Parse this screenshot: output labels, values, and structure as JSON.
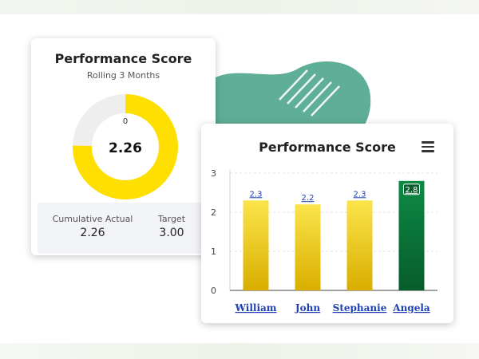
{
  "left_card": {
    "title": "Performance Score",
    "subtitle": "Rolling 3 Months",
    "donut": {
      "value": 2.26,
      "min_label": "0",
      "center_label": "2.26",
      "fraction": 0.753,
      "color": "#FFDF00",
      "track_color": "#EEEEEE"
    },
    "stats": [
      {
        "label": "Cumulative Actual",
        "value": "2.26"
      },
      {
        "label": "Target",
        "value": "3.00"
      }
    ]
  },
  "right_card": {
    "title": "Performance Score",
    "menu_icon": "hamburger-menu-icon"
  },
  "chart_data": {
    "type": "bar",
    "title": "Performance Score",
    "categories": [
      "William",
      "John",
      "Stephanie",
      "Angela"
    ],
    "values": [
      2.3,
      2.2,
      2.3,
      2.8
    ],
    "data_labels": [
      "2.3",
      "2.2",
      "2.3",
      "2.8"
    ],
    "bar_colors": [
      "#F2C511",
      "#F2C511",
      "#F2C511",
      "#0B7A3B"
    ],
    "y_ticks": [
      "0",
      "1",
      "2",
      "3"
    ],
    "ylim": [
      0,
      3
    ],
    "grid": true,
    "legend": "none"
  },
  "colors": {
    "accent_yellow": "#FFDF00",
    "accent_green": "#0B7A3B",
    "link_blue": "#1F3FB5",
    "decor_teal": "#5FAE98"
  }
}
